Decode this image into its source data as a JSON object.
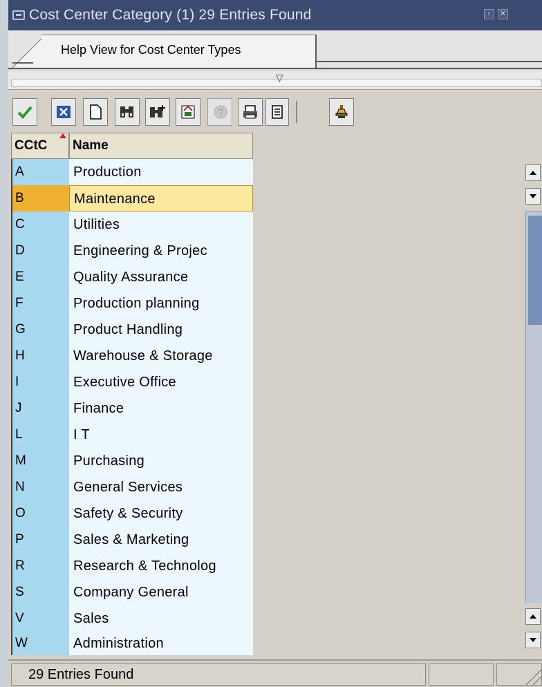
{
  "window": {
    "title": "Cost Center Category (1)   29 Entries Found",
    "minimize_label": "▫",
    "close_label": "✕"
  },
  "tab": {
    "label": "Help View for Cost Center Types"
  },
  "splitter": {
    "arrow": "▽"
  },
  "toolbar": {
    "buttons": [
      {
        "name": "continue",
        "icon": "check-icon"
      },
      {
        "name": "cancel",
        "icon": "close-icon"
      },
      {
        "name": "new-selection",
        "icon": "document-icon"
      },
      {
        "name": "find",
        "icon": "binoculars-icon"
      },
      {
        "name": "find-next",
        "icon": "binoculars-plus-icon"
      },
      {
        "name": "sort",
        "icon": "sort-icon"
      },
      {
        "name": "help",
        "icon": "help-icon"
      },
      {
        "name": "print",
        "icon": "printer-icon"
      },
      {
        "name": "print-preview",
        "icon": "preview-icon"
      },
      {
        "name": "personal-value-list",
        "icon": "bell-icon"
      }
    ]
  },
  "table": {
    "columns": [
      "CCtC",
      "Name"
    ],
    "sort_indicator": "ascending",
    "selected_index": 1,
    "rows": [
      {
        "key": "A",
        "name": "Production"
      },
      {
        "key": "B",
        "name": "Maintenance"
      },
      {
        "key": "C",
        "name": "Utilities"
      },
      {
        "key": "D",
        "name": "Engineering & Projec"
      },
      {
        "key": "E",
        "name": "Quality Assurance"
      },
      {
        "key": "F",
        "name": "Production planning"
      },
      {
        "key": "G",
        "name": "Product Handling"
      },
      {
        "key": "H",
        "name": "Warehouse  & Storage"
      },
      {
        "key": "I",
        "name": "Executive Office"
      },
      {
        "key": "J",
        "name": "Finance"
      },
      {
        "key": "L",
        "name": "I T"
      },
      {
        "key": "M",
        "name": "Purchasing"
      },
      {
        "key": "N",
        "name": "General Services"
      },
      {
        "key": "O",
        "name": "Safety & Security"
      },
      {
        "key": "P",
        "name": "Sales & Marketing"
      },
      {
        "key": "R",
        "name": "Research & Technolog"
      },
      {
        "key": "S",
        "name": "Company General"
      },
      {
        "key": "V",
        "name": "Sales"
      },
      {
        "key": "W",
        "name": "Administration"
      }
    ]
  },
  "status": {
    "message": "29 Entries Found"
  },
  "colors": {
    "title_bar": "#3a4a70",
    "key_column": "#a8d8f0",
    "name_column": "#ecf8fd",
    "selected_key": "#f0b030",
    "selected_name": "#fde8a0"
  }
}
